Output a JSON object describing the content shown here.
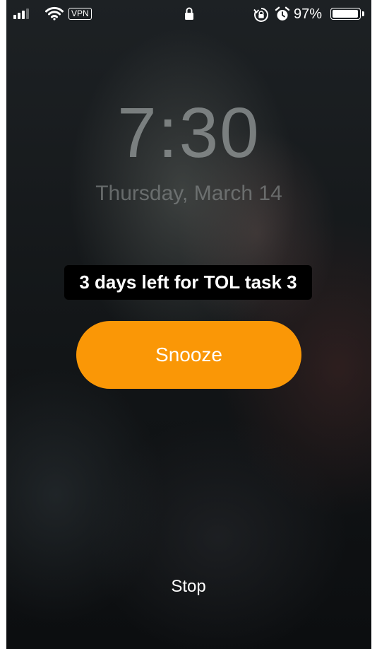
{
  "status_bar": {
    "vpn_label": "VPN",
    "battery_percent": "97%",
    "battery_level": 0.97,
    "signal_bars_filled": 3,
    "signal_bars_total": 4,
    "icons": [
      "signal-icon",
      "wifi-icon",
      "vpn-badge",
      "lock-icon",
      "rotation-lock-icon",
      "alarm-icon",
      "battery-icon"
    ]
  },
  "lock_screen": {
    "time": "7:30",
    "date": "Thursday, March 14"
  },
  "reminder_banner": {
    "text": "3 days left for TOL task 3"
  },
  "alarm": {
    "snooze_label": "Snooze",
    "stop_label": "Stop",
    "accent_color": "#fa9706"
  }
}
